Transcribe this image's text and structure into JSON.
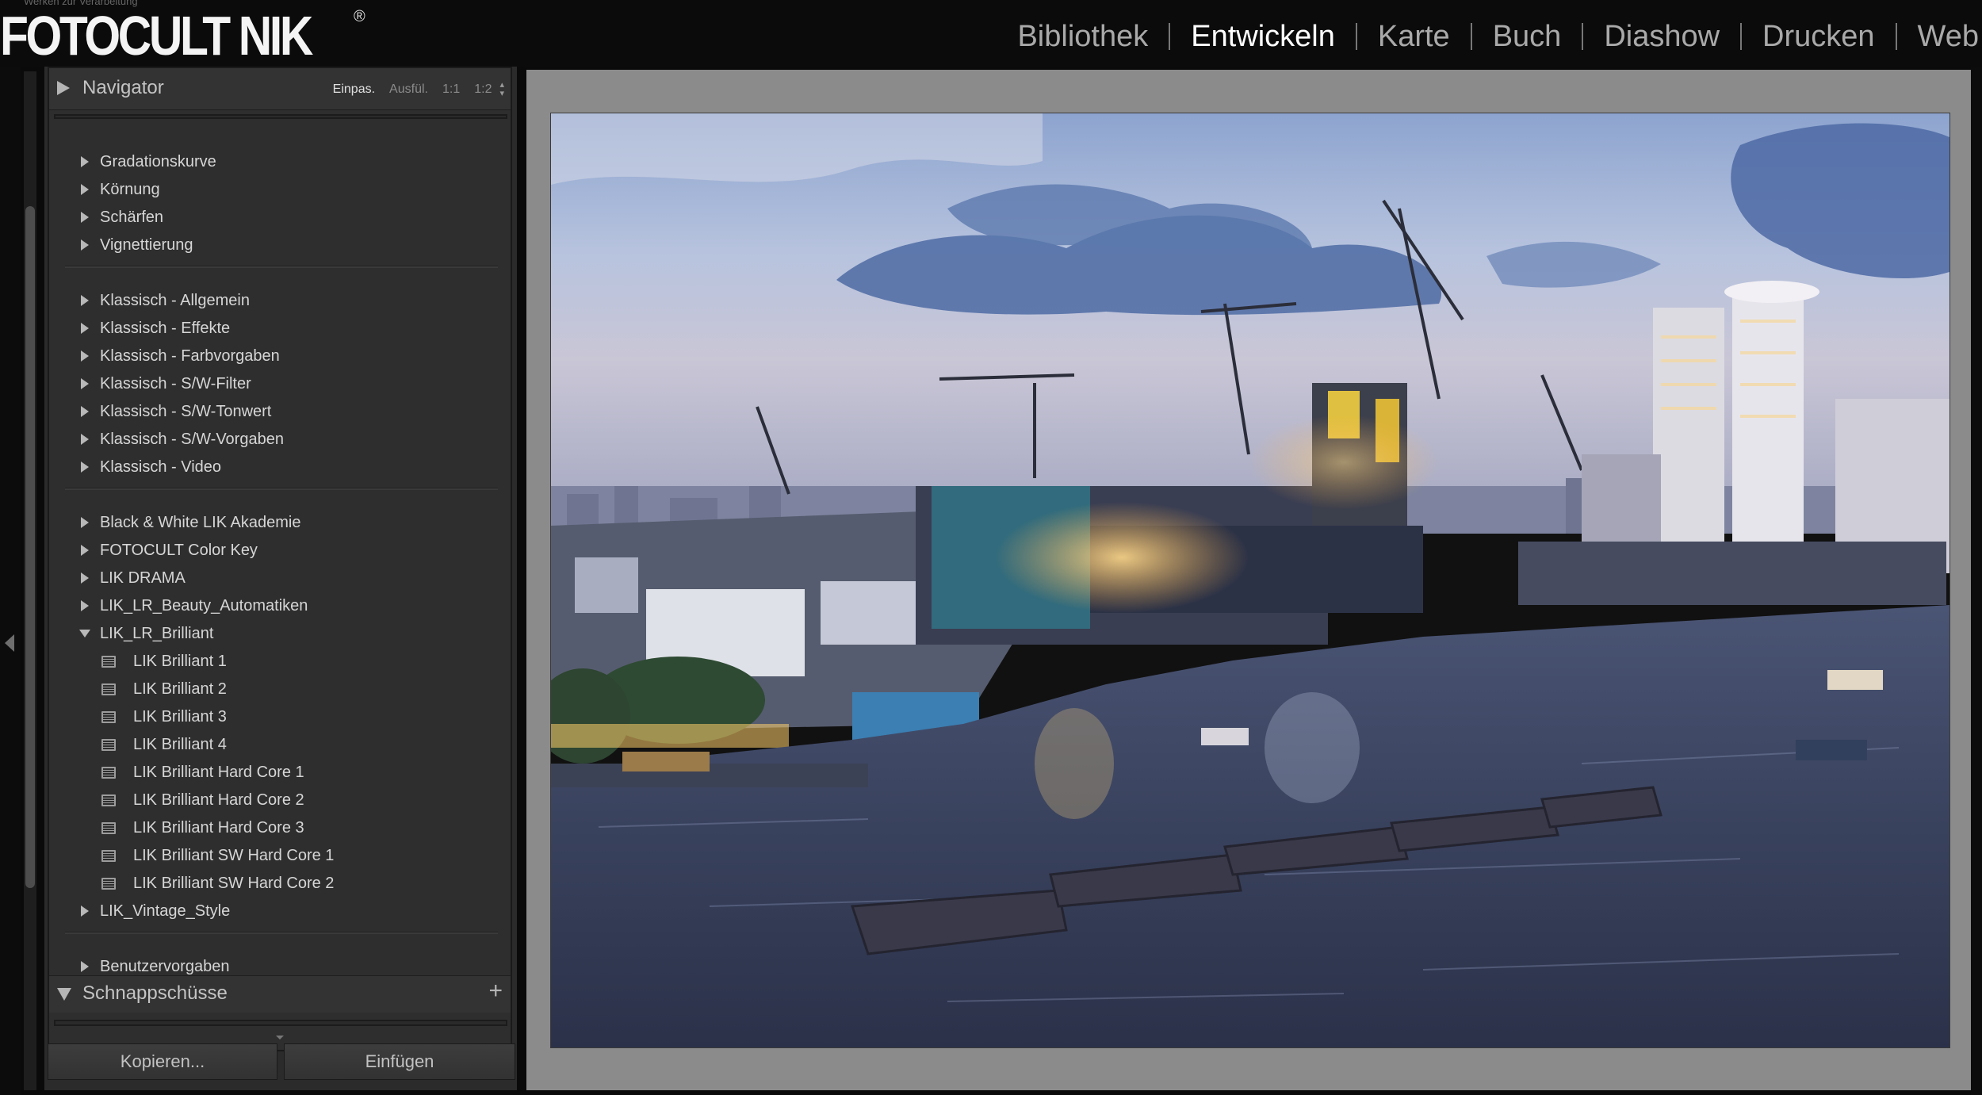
{
  "brand": {
    "logo_text": "FOTOCULT NIK",
    "logo_mark": "®",
    "tagline": "Werken zur Verarbeitung"
  },
  "modules": [
    {
      "label": "Bibliothek",
      "active": false
    },
    {
      "label": "Entwickeln",
      "active": true
    },
    {
      "label": "Karte",
      "active": false
    },
    {
      "label": "Buch",
      "active": false
    },
    {
      "label": "Diashow",
      "active": false
    },
    {
      "label": "Drucken",
      "active": false
    },
    {
      "label": "Web",
      "active": false
    }
  ],
  "navigator": {
    "title": "Navigator",
    "zoom_options": [
      "Einpas.",
      "Ausfül.",
      "1:1",
      "1:2"
    ],
    "selected_zoom": "Einpas."
  },
  "presets": {
    "group1": [
      "Gradationskurve",
      "Körnung",
      "Schärfen",
      "Vignettierung"
    ],
    "group2": [
      "Klassisch - Allgemein",
      "Klassisch - Effekte",
      "Klassisch - Farbvorgaben",
      "Klassisch - S/W-Filter",
      "Klassisch - S/W-Tonwert",
      "Klassisch - S/W-Vorgaben",
      "Klassisch - Video"
    ],
    "group3": [
      "Black & White LIK Akademie",
      "FOTOCULT Color Key",
      "LIK DRAMA",
      "LIK_LR_Beauty_Automatiken"
    ],
    "expanded_folder": "LIK_LR_Brilliant",
    "expanded_items": [
      "LIK Brilliant 1",
      "LIK Brilliant 2",
      "LIK Brilliant 3",
      "LIK Brilliant 4",
      "LIK Brilliant Hard Core 1",
      "LIK Brilliant Hard Core 2",
      "LIK Brilliant Hard Core 3",
      "LIK Brilliant SW Hard Core 1",
      "LIK Brilliant SW Hard Core 2"
    ],
    "after_expanded": "LIK_Vintage_Style",
    "group4": [
      "Benutzervorgaben"
    ]
  },
  "snapshots": {
    "title": "Schnappschüsse",
    "add_symbol": "+"
  },
  "buttons": {
    "copy": "Kopieren...",
    "paste": "Einfügen"
  },
  "colors": {
    "background": "#0a0a0a",
    "panel": "#2e2e2e",
    "canvas": "#8b8b8b",
    "active_module": "#ffffff",
    "inactive_module": "#a9a9a9"
  }
}
